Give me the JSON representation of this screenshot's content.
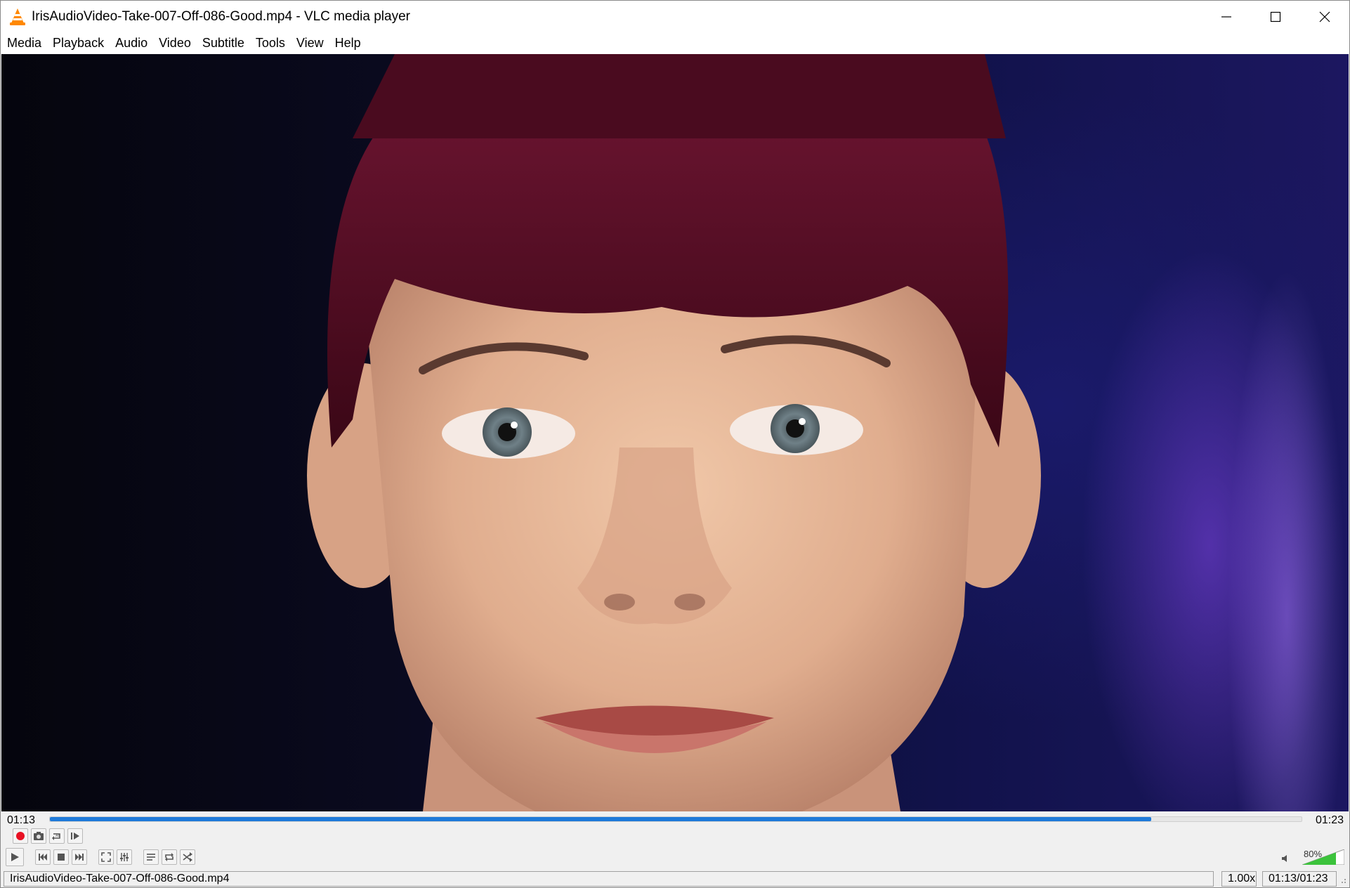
{
  "window": {
    "title": "IrisAudioVideo-Take-007-Off-086-Good.mp4 - VLC media player",
    "controls": [
      "minimize-icon",
      "maximize-icon",
      "close-icon"
    ]
  },
  "menu": {
    "items": [
      "Media",
      "Playback",
      "Audio",
      "Video",
      "Subtitle",
      "Tools",
      "View",
      "Help"
    ]
  },
  "playback": {
    "elapsed": "01:13",
    "total": "01:23",
    "progress": 0.88
  },
  "controls": {
    "top_row_icons": [
      "record-icon",
      "snapshot-icon",
      "ab-loop-icon",
      "frame-step-icon"
    ],
    "bottom_row_icons": [
      "play-icon",
      "previous-icon",
      "stop-icon",
      "next-icon",
      "fullscreen-icon",
      "extended-settings-icon",
      "playlist-icon",
      "loop-icon",
      "shuffle-icon"
    ]
  },
  "volume": {
    "label": "80%",
    "level": 0.8
  },
  "status": {
    "filename": "IrisAudioVideo-Take-007-Off-086-Good.mp4",
    "speed": "1.00x",
    "time": "01:13/01:23"
  },
  "colors": {
    "accent": "#1f7ad9",
    "record": "#e81123",
    "volume_fill": "#3cc33c",
    "hair": "#5a0f2a",
    "skin": "#e2b497"
  }
}
